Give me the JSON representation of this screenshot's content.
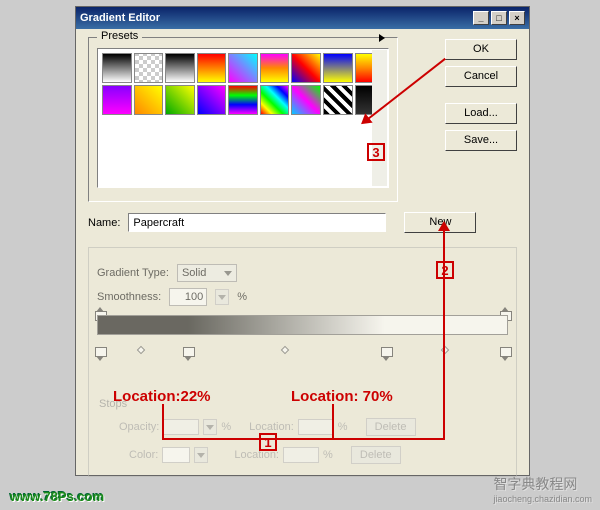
{
  "window": {
    "title": "Gradient Editor"
  },
  "buttons": {
    "ok": "OK",
    "cancel": "Cancel",
    "load": "Load...",
    "save": "Save...",
    "new": "New",
    "delete": "Delete"
  },
  "presets": {
    "label": "Presets"
  },
  "name": {
    "label": "Name:",
    "value": "Papercraft"
  },
  "gradientType": {
    "label": "Gradient Type:",
    "value": "Solid"
  },
  "smoothness": {
    "label": "Smoothness:",
    "value": "100",
    "unit": "%"
  },
  "stops": {
    "label": "Stops",
    "opacity_label": "Opacity:",
    "opacity_unit": "%",
    "location_label": "Location:",
    "location_unit": "%",
    "color_label": "Color:"
  },
  "annotations": {
    "loc1": "Location:22%",
    "loc2": "Location: 70%",
    "box1": "1",
    "box2": "2",
    "box3": "3"
  },
  "branding": {
    "logo": "www.78Ps.com",
    "watermark": "智字典教程网",
    "watermark_sub": "jiaocheng.chazidian.com"
  },
  "swatch_gradients": [
    [
      "linear-gradient(#000,#fff)",
      "repeating-conic-gradient(#ccc 0 25%,#fff 0 50%) 0/8px 8px",
      "linear-gradient(#000,#fff)",
      "linear-gradient(#f00,#ff0)",
      "linear-gradient(45deg,#f0f,#0ff)",
      "linear-gradient(#f0f,#f80,#ff0)",
      "linear-gradient(45deg,#00f,#f00,#ff0)",
      "linear-gradient(#00f,#ff0)",
      "linear-gradient(#ff0,#f80,#f00)"
    ],
    [
      "linear-gradient(#80f,#f0f)",
      "linear-gradient(45deg,#f80,#ff0)",
      "linear-gradient(45deg,#0a0,#ff0)",
      "linear-gradient(45deg,#00f,#f0f)",
      "linear-gradient(#f00,#0f0,#00f,#f0f)",
      "linear-gradient(45deg,#f00,#ff0,#0f0,#0ff,#00f,#f0f)",
      "linear-gradient(45deg,#0cf,#f0f,#0f0)",
      "repeating-linear-gradient(45deg,#000 0 4px,#fff 4px 8px)",
      "linear-gradient(#000,#333)"
    ]
  ],
  "chart_data": {
    "type": "gradient",
    "stops": [
      {
        "pos": 0,
        "color": "#000000"
      },
      {
        "pos": 22,
        "color": "#000000"
      },
      {
        "pos": 70,
        "color": "#ffffff"
      },
      {
        "pos": 100,
        "color": "#ffffff"
      }
    ],
    "opacity_stops": [
      {
        "pos": 0,
        "opacity": 100
      },
      {
        "pos": 100,
        "opacity": 100
      }
    ],
    "midpoints": [
      11,
      46,
      85
    ]
  }
}
